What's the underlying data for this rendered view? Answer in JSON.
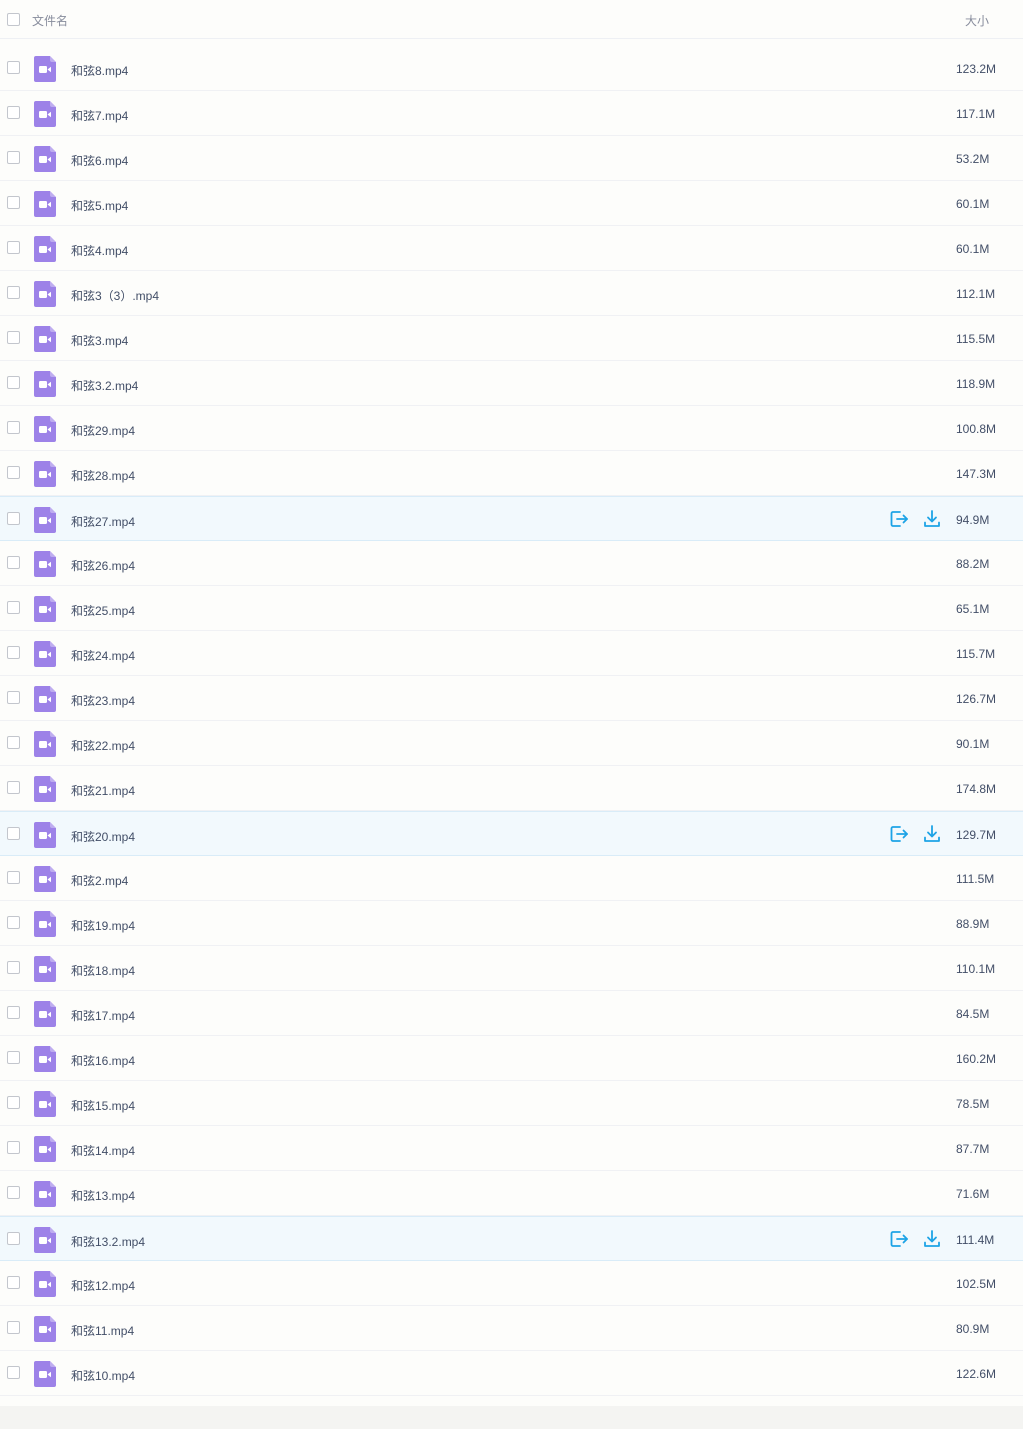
{
  "header": {
    "name_label": "文件名",
    "size_label": "大小"
  },
  "colors": {
    "file_icon": "#9d82e8",
    "action_icon": "#1da3e6",
    "hover_row": "#f2f9fd"
  },
  "rows": [
    {
      "name": "和弦8.mp4",
      "size": "123.2M",
      "hover": false
    },
    {
      "name": "和弦7.mp4",
      "size": "117.1M",
      "hover": false
    },
    {
      "name": "和弦6.mp4",
      "size": "53.2M",
      "hover": false
    },
    {
      "name": "和弦5.mp4",
      "size": "60.1M",
      "hover": false
    },
    {
      "name": "和弦4.mp4",
      "size": "60.1M",
      "hover": false
    },
    {
      "name": "和弦3（3）.mp4",
      "size": "112.1M",
      "hover": false
    },
    {
      "name": "和弦3.mp4",
      "size": "115.5M",
      "hover": false
    },
    {
      "name": "和弦3.2.mp4",
      "size": "118.9M",
      "hover": false
    },
    {
      "name": "和弦29.mp4",
      "size": "100.8M",
      "hover": false
    },
    {
      "name": "和弦28.mp4",
      "size": "147.3M",
      "hover": false
    },
    {
      "name": "和弦27.mp4",
      "size": "94.9M",
      "hover": true
    },
    {
      "name": "和弦26.mp4",
      "size": "88.2M",
      "hover": false
    },
    {
      "name": "和弦25.mp4",
      "size": "65.1M",
      "hover": false
    },
    {
      "name": "和弦24.mp4",
      "size": "115.7M",
      "hover": false
    },
    {
      "name": "和弦23.mp4",
      "size": "126.7M",
      "hover": false
    },
    {
      "name": "和弦22.mp4",
      "size": "90.1M",
      "hover": false
    },
    {
      "name": "和弦21.mp4",
      "size": "174.8M",
      "hover": false
    },
    {
      "name": "和弦20.mp4",
      "size": "129.7M",
      "hover": true
    },
    {
      "name": "和弦2.mp4",
      "size": "111.5M",
      "hover": false
    },
    {
      "name": "和弦19.mp4",
      "size": "88.9M",
      "hover": false
    },
    {
      "name": "和弦18.mp4",
      "size": "110.1M",
      "hover": false
    },
    {
      "name": "和弦17.mp4",
      "size": "84.5M",
      "hover": false
    },
    {
      "name": "和弦16.mp4",
      "size": "160.2M",
      "hover": false
    },
    {
      "name": "和弦15.mp4",
      "size": "78.5M",
      "hover": false
    },
    {
      "name": "和弦14.mp4",
      "size": "87.7M",
      "hover": false
    },
    {
      "name": "和弦13.mp4",
      "size": "71.6M",
      "hover": false
    },
    {
      "name": "和弦13.2.mp4",
      "size": "111.4M",
      "hover": true
    },
    {
      "name": "和弦12.mp4",
      "size": "102.5M",
      "hover": false
    },
    {
      "name": "和弦11.mp4",
      "size": "80.9M",
      "hover": false
    },
    {
      "name": "和弦10.mp4",
      "size": "122.6M",
      "hover": false
    }
  ]
}
